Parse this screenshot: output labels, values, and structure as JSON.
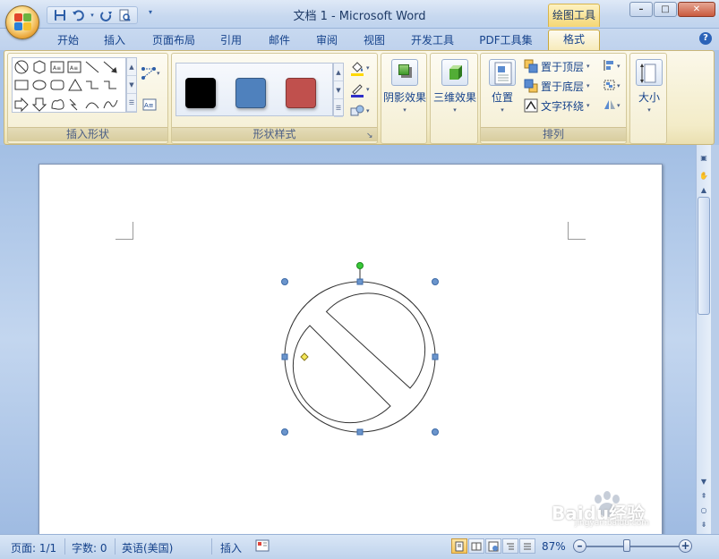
{
  "window": {
    "title": "文档 1 - Microsoft Word",
    "context_tab_group": "绘图工具",
    "controls": {
      "minimize": "–",
      "maximize": "□",
      "close": "✕"
    }
  },
  "quick_access": {
    "icons": [
      "save-icon",
      "undo-icon",
      "redo-icon",
      "print-preview-icon",
      "customize-dropdown-icon"
    ]
  },
  "tabs": [
    {
      "label": "开始"
    },
    {
      "label": "插入"
    },
    {
      "label": "页面布局"
    },
    {
      "label": "引用"
    },
    {
      "label": "邮件"
    },
    {
      "label": "审阅"
    },
    {
      "label": "视图"
    },
    {
      "label": "开发工具"
    },
    {
      "label": "PDF工具集"
    },
    {
      "label": "格式",
      "active": true
    }
  ],
  "ribbon": {
    "insert_shapes": {
      "label": "插入形状"
    },
    "shape_styles": {
      "label": "形状样式",
      "swatches": [
        {
          "name": "black",
          "color": "#000000"
        },
        {
          "name": "blue",
          "color": "#4f81bd"
        },
        {
          "name": "red",
          "color": "#c0504d"
        }
      ]
    },
    "shadow_effects": {
      "label": "阴影效果"
    },
    "threed_effects": {
      "label": "三维效果"
    },
    "arrange": {
      "label": "排列",
      "position": "位置",
      "bring_to_front": "置于顶层",
      "send_to_back": "置于底层",
      "text_wrapping": "文字环绕"
    },
    "size": {
      "label": "大小"
    }
  },
  "status": {
    "page": "页面: 1/1",
    "words": "字数: 0",
    "language": "英语(美国)",
    "mode": "插入",
    "zoom": "87%",
    "zoom_minus": "–",
    "zoom_plus": "+"
  },
  "watermark": {
    "text": "Baidu经验",
    "subtext": "jingyan.baidu.com"
  },
  "colors": {
    "accent": "#15428b",
    "selection_handle": "#6b95cc",
    "rotation_handle": "#38c838",
    "adjust_handle": "#f5e85a"
  }
}
